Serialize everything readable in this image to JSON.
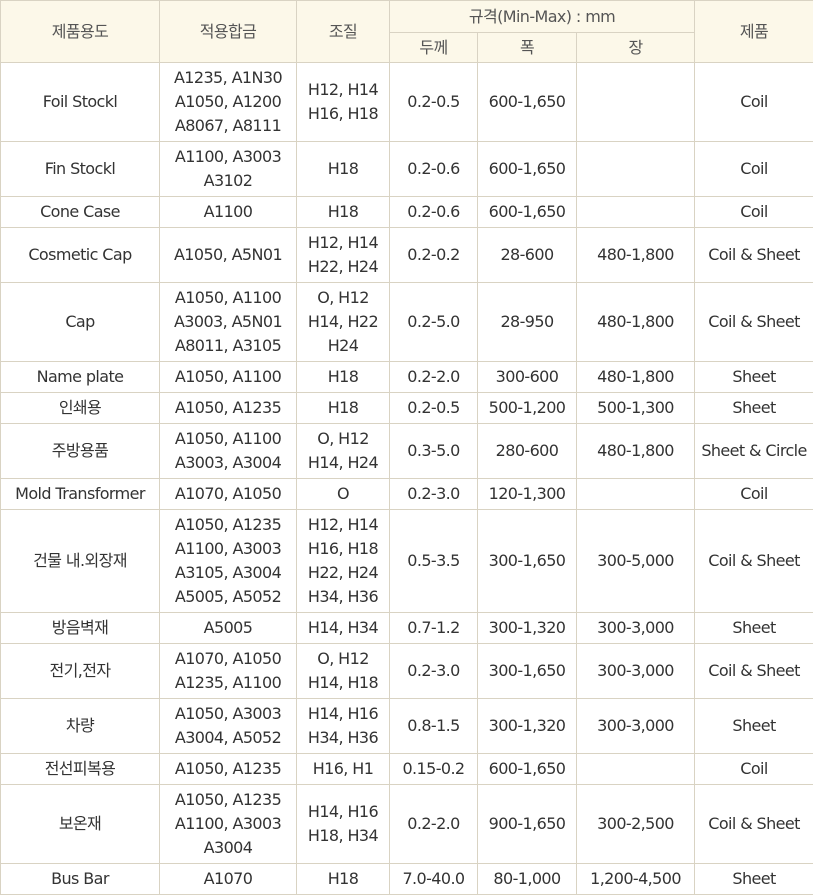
{
  "header": {
    "usage": "제품용도",
    "alloy": "적용합금",
    "temper": "조질",
    "spec": "규격(Min-Max) : mm",
    "thickness": "두께",
    "width": "폭",
    "length": "장",
    "product": "제품"
  },
  "rows": [
    {
      "usage": "Foil Stockl",
      "alloy": [
        "A1235, A1N30",
        "A1050, A1200",
        "A8067, A8111"
      ],
      "temper": [
        "H12, H14",
        "H16, H18"
      ],
      "thickness": "0.2-0.5",
      "width": "600-1,650",
      "length": "",
      "product": "Coil",
      "h": 79
    },
    {
      "usage": "Fin Stockl",
      "alloy": [
        "A1100, A3003",
        "A3102"
      ],
      "temper": [
        "H18"
      ],
      "thickness": "0.2-0.6",
      "width": "600-1,650",
      "length": "",
      "product": "Coil",
      "h": 55
    },
    {
      "usage": "Cone Case",
      "alloy": [
        "A1100"
      ],
      "temper": [
        "H18"
      ],
      "thickness": "0.2-0.6",
      "width": "600-1,650",
      "length": "",
      "product": "Coil",
      "h": 31
    },
    {
      "usage": "Cosmetic Cap",
      "alloy": [
        "A1050, A5N01"
      ],
      "temper": [
        "H12, H14",
        "H22, H24"
      ],
      "thickness": "0.2-0.2",
      "width": "28-600",
      "length": "480-1,800",
      "product": "Coil & Sheet",
      "h": 55
    },
    {
      "usage": "Cap",
      "alloy": [
        "A1050, A1100",
        "A3003, A5N01",
        "A8011, A3105"
      ],
      "temper": [
        "O, H12",
        "H14, H22",
        "H24"
      ],
      "thickness": "0.2-5.0",
      "width": "28-950",
      "length": "480-1,800",
      "product": "Coil & Sheet",
      "h": 79
    },
    {
      "usage": "Name plate",
      "alloy": [
        "A1050, A1100"
      ],
      "temper": [
        "H18"
      ],
      "thickness": "0.2-2.0",
      "width": "300-600",
      "length": "480-1,800",
      "product": "Sheet",
      "h": 31
    },
    {
      "usage": "인쇄용",
      "alloy": [
        "A1050, A1235"
      ],
      "temper": [
        "H18"
      ],
      "thickness": "0.2-0.5",
      "width": "500-1,200",
      "length": "500-1,300",
      "product": "Sheet",
      "h": 31
    },
    {
      "usage": "주방용품",
      "alloy": [
        "A1050, A1100",
        "A3003, A3004"
      ],
      "temper": [
        "O, H12",
        "H14, H24"
      ],
      "thickness": "0.3-5.0",
      "width": "280-600",
      "length": "480-1,800",
      "product": "Sheet & Circle",
      "h": 55
    },
    {
      "usage": "Mold Transformer",
      "alloy": [
        "A1070, A1050"
      ],
      "temper": [
        "O"
      ],
      "thickness": "0.2-3.0",
      "width": "120-1,300",
      "length": "",
      "product": "Coil",
      "h": 31
    },
    {
      "usage": "건물 내.외장재",
      "alloy": [
        "A1050, A1235",
        "A1100, A3003",
        "A3105, A3004",
        "A5005, A5052"
      ],
      "temper": [
        "H12, H14",
        "H16, H18",
        "H22, H24",
        "H34, H36"
      ],
      "thickness": "0.5-3.5",
      "width": "300-1,650",
      "length": "300-5,000",
      "product": "Coil & Sheet",
      "h": 103
    },
    {
      "usage": "방음벽재",
      "alloy": [
        "A5005"
      ],
      "temper": [
        "H14, H34"
      ],
      "thickness": "0.7-1.2",
      "width": "300-1,320",
      "length": "300-3,000",
      "product": "Sheet",
      "h": 31
    },
    {
      "usage": "전기,전자",
      "alloy": [
        "A1070, A1050",
        "A1235, A1100"
      ],
      "temper": [
        "O, H12",
        "H14, H18"
      ],
      "thickness": "0.2-3.0",
      "width": "300-1,650",
      "length": "300-3,000",
      "product": "Coil & Sheet",
      "h": 55
    },
    {
      "usage": "차량",
      "alloy": [
        "A1050, A3003",
        "A3004, A5052"
      ],
      "temper": [
        "H14, H16",
        "H34, H36"
      ],
      "thickness": "0.8-1.5",
      "width": "300-1,320",
      "length": "300-3,000",
      "product": "Sheet",
      "h": 55
    },
    {
      "usage": "전선피복용",
      "alloy": [
        "A1050, A1235"
      ],
      "temper": [
        "H16, H1"
      ],
      "thickness": "0.15-0.2",
      "width": "600-1,650",
      "length": "",
      "product": "Coil",
      "h": 31
    },
    {
      "usage": "보온재",
      "alloy": [
        "A1050, A1235",
        "A1100, A3003",
        "A3004"
      ],
      "temper": [
        "H14, H16",
        "H18, H34"
      ],
      "thickness": "0.2-2.0",
      "width": "900-1,650",
      "length": "300-2,500",
      "product": "Coil & Sheet",
      "h": 79
    },
    {
      "usage": "Bus Bar",
      "alloy": [
        "A1070"
      ],
      "temper": [
        "H18"
      ],
      "thickness": "7.0-40.0",
      "width": "80-1,000",
      "length": "1,200-4,500",
      "product": "Sheet",
      "h": 31
    }
  ]
}
